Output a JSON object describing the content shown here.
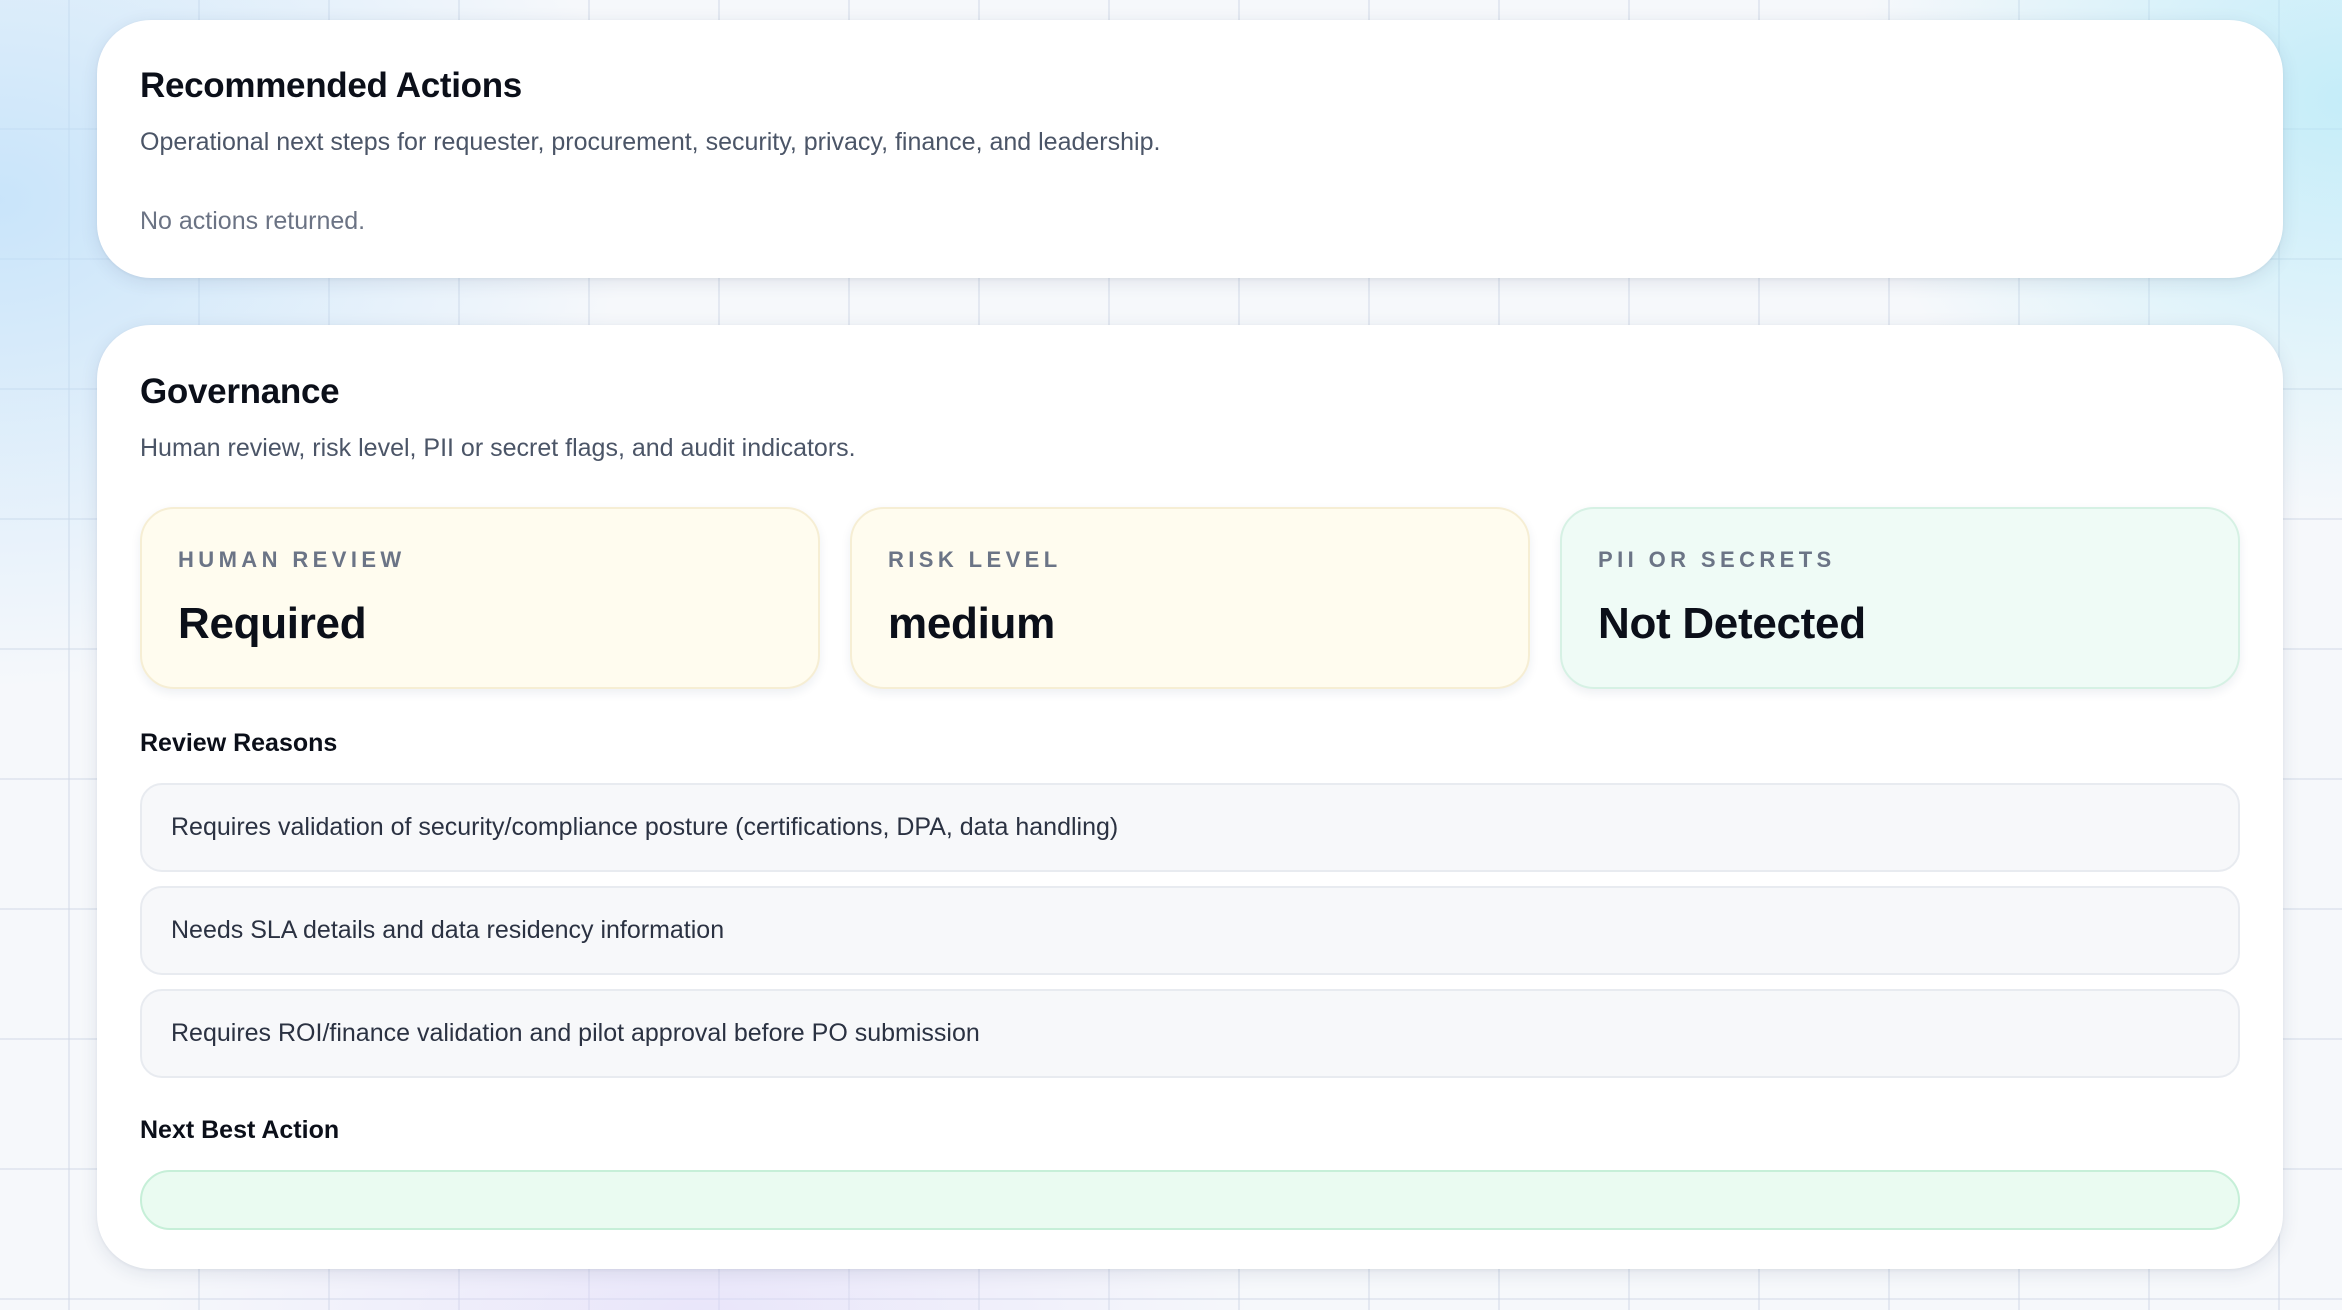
{
  "recommended_actions": {
    "title": "Recommended Actions",
    "subtitle": "Operational next steps for requester, procurement, security, privacy, finance, and leadership.",
    "empty_message": "No actions returned."
  },
  "governance": {
    "title": "Governance",
    "subtitle": "Human review, risk level, PII or secret flags, and audit indicators.",
    "metrics": [
      {
        "label": "HUMAN REVIEW",
        "value": "Required",
        "tone": "warning",
        "background": "#fffcef"
      },
      {
        "label": "RISK LEVEL",
        "value": "medium",
        "tone": "warning",
        "background": "#fffcef"
      },
      {
        "label": "PII OR SECRETS",
        "value": "Not Detected",
        "tone": "success",
        "background": "#effbf6"
      }
    ],
    "review_reasons_heading": "Review Reasons",
    "review_reasons": [
      "Requires validation of security/compliance posture (certifications, DPA, data handling)",
      "Needs SLA details and data residency information",
      "Requires ROI/finance validation and pilot approval before PO submission"
    ],
    "next_best_action_heading": "Next Best Action",
    "next_best_action": "",
    "colors": {
      "warning_bg": "#fffcef",
      "success_bg": "#effbf6",
      "next_action_bg": "#eafbf1"
    }
  }
}
